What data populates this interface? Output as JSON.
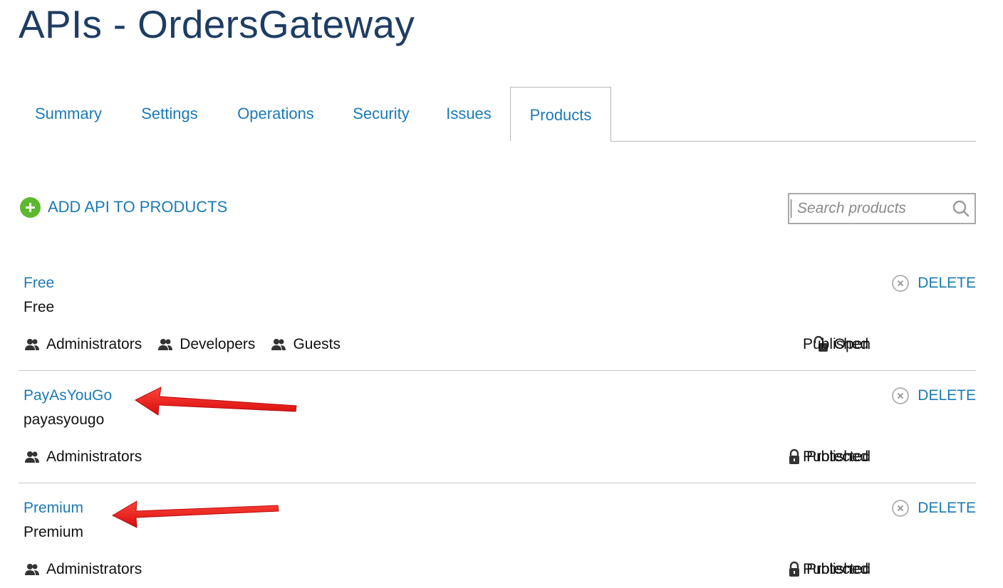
{
  "page": {
    "title": "APIs - OrdersGateway"
  },
  "tabs": [
    {
      "label": "Summary",
      "active": false
    },
    {
      "label": "Settings",
      "active": false
    },
    {
      "label": "Operations",
      "active": false
    },
    {
      "label": "Security",
      "active": false
    },
    {
      "label": "Issues",
      "active": false
    },
    {
      "label": "Products",
      "active": true
    }
  ],
  "toolbar": {
    "add_label": "ADD API TO PRODUCTS"
  },
  "search": {
    "placeholder": "Search products",
    "value": ""
  },
  "products": [
    {
      "name": "Free",
      "description": "Free",
      "delete_label": "DELETE",
      "groups": [
        "Administrators",
        "Developers",
        "Guests"
      ],
      "access": "Open",
      "access_icon": "unlock-icon",
      "status": "Published"
    },
    {
      "name": "PayAsYouGo",
      "description": "payasyougo",
      "delete_label": "DELETE",
      "groups": [
        "Administrators"
      ],
      "access": "Protected",
      "access_icon": "lock-icon",
      "status": "Published"
    },
    {
      "name": "Premium",
      "description": "Premium",
      "delete_label": "DELETE",
      "groups": [
        "Administrators"
      ],
      "access": "Protected",
      "access_icon": "lock-icon",
      "status": "Published"
    }
  ],
  "colors": {
    "link": "#1b7ab5",
    "title": "#1f3d63",
    "add": "#5cb82f",
    "annotation": "#ff0000"
  }
}
